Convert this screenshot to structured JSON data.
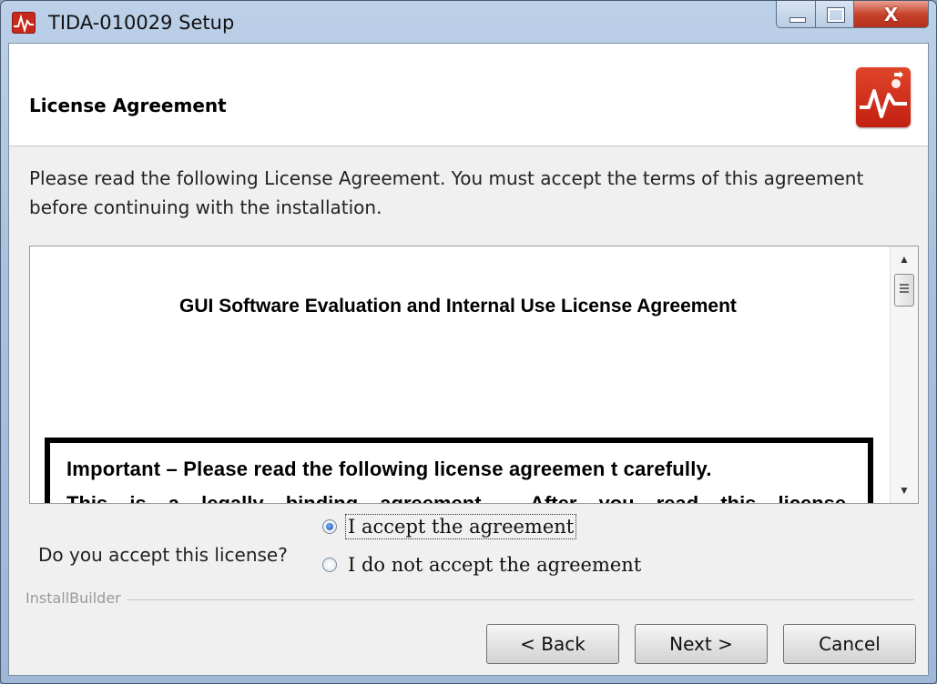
{
  "window": {
    "title": "TIDA-010029 Setup",
    "close_glyph": "X"
  },
  "header": {
    "title": "License Agreement",
    "icon": "ti-logo-waveform-icon"
  },
  "intro_text": "Please read the following License Agreement. You must accept the terms of this agreement before continuing with the installation.",
  "license": {
    "heading": "GUI Software Evaluation and Internal Use License Agreement",
    "important_line1": "Important – Please read the following license agreemen  t carefully.",
    "important_line2": "This is a legally binding agreement . After you read this license"
  },
  "accept": {
    "question": "Do you accept this license?",
    "options": [
      {
        "label": "I accept the agreement",
        "selected": true
      },
      {
        "label": "I do not accept the agreement",
        "selected": false
      }
    ]
  },
  "footer": {
    "brand": "InstallBuilder",
    "back_label": "< Back",
    "next_label": "Next >",
    "cancel_label": "Cancel"
  },
  "colors": {
    "accent_red": "#c62a1c",
    "window_frame": "#a9c1de"
  }
}
